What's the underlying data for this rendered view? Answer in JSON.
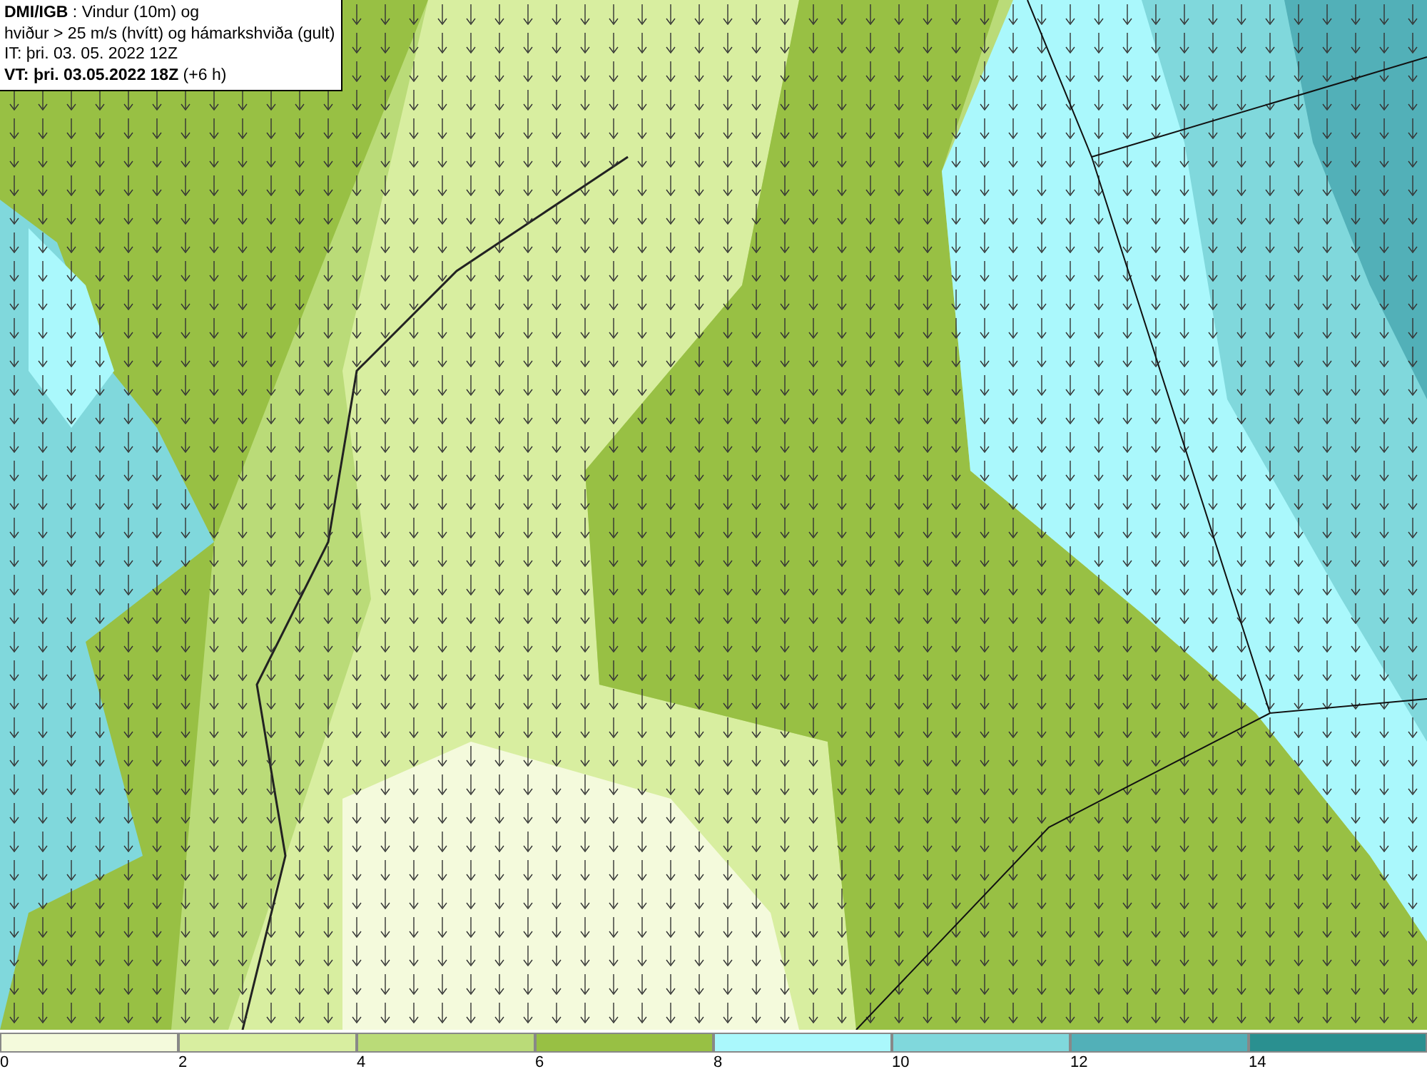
{
  "title_box": {
    "lines": [
      "**DMI/IGB** : Vindur (10m) og",
      "hviður > 25 m/s (hvítt) og hámarkshviða (gult)",
      "IT: þri. 03. 05. 2022 12Z",
      "**VT: þri. 03.05.2022 18Z** (+6 h)"
    ]
  },
  "legend": {
    "bins": [
      {
        "label": "0",
        "color": "#f4fadc"
      },
      {
        "label": "2",
        "color": "#d8eea0"
      },
      {
        "label": "4",
        "color": "#badb78"
      },
      {
        "label": "6",
        "color": "#98c044"
      },
      {
        "label": "8",
        "color": "#aaf8fc"
      },
      {
        "label": "10",
        "color": "#80d8dc"
      },
      {
        "label": "12",
        "color": "#52b0b8"
      },
      {
        "label": "14",
        "color": "#2a9090"
      }
    ]
  }
}
